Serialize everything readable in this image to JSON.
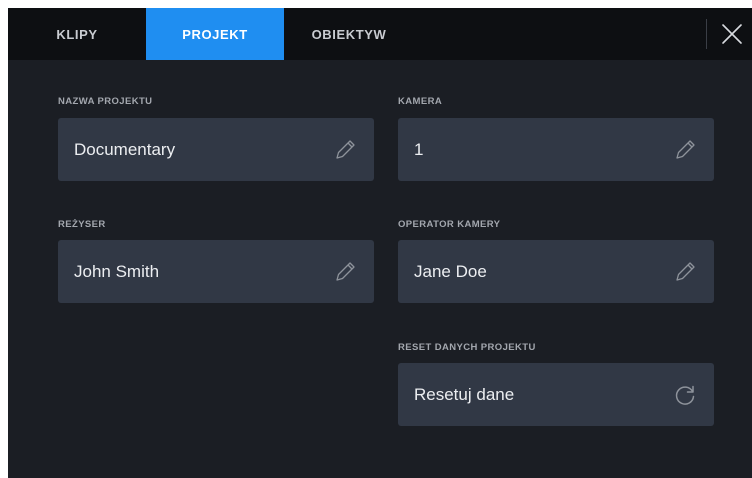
{
  "tabs": [
    {
      "label": "KLIPY",
      "active": false
    },
    {
      "label": "PROJEKT",
      "active": true
    },
    {
      "label": "OBIEKTYW",
      "active": false
    }
  ],
  "close_icon": "close-icon",
  "fields": {
    "project_name": {
      "label": "NAZWA PROJEKTU",
      "value": "Documentary",
      "icon": "pencil-icon"
    },
    "camera": {
      "label": "KAMERA",
      "value": "1",
      "icon": "pencil-icon"
    },
    "director": {
      "label": "REŻYSER",
      "value": "John Smith",
      "icon": "pencil-icon"
    },
    "camera_operator": {
      "label": "OPERATOR KAMERY",
      "value": "Jane Doe",
      "icon": "pencil-icon"
    },
    "reset": {
      "label": "RESET DANYCH PROJEKTU",
      "value": "Resetuj dane",
      "icon": "refresh-icon"
    }
  },
  "colors": {
    "accent": "#1f8ef1",
    "background": "#1b1e24",
    "tabbar": "#0d0f12",
    "field": "#313845"
  }
}
